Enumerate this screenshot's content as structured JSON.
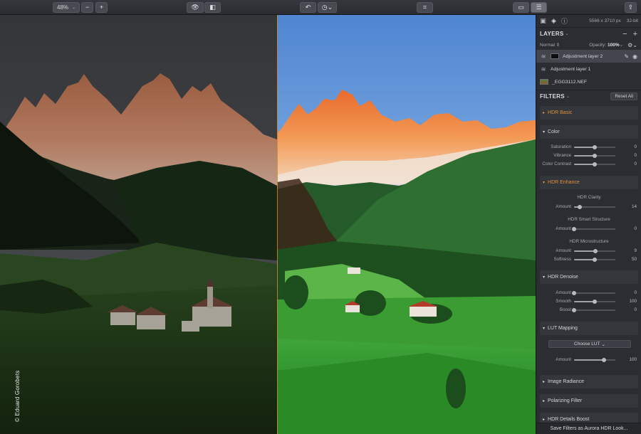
{
  "toolbar": {
    "zoom_value": "48%",
    "zoom_caret": "⌄",
    "zoom_out": "−",
    "zoom_in": "+",
    "icons": {
      "preview": "eye-icon",
      "compare": "split-compare-icon",
      "undo": "undo-icon",
      "history": "history-icon",
      "crop": "crop-icon",
      "layers_view": "panel-view-icon",
      "adjustments": "sliders-icon",
      "share": "share-icon"
    },
    "glyphs": {
      "preview": "👁",
      "compare": "◧",
      "undo": "↶",
      "history": "◷⌄",
      "crop": "⌗",
      "layers_view": "▭",
      "adjustments": "☰",
      "share": "⇪"
    }
  },
  "canvas": {
    "credit": "© Eduard Gorobets"
  },
  "panel": {
    "image_dimensions": "5566 x 3710 px",
    "bit_depth": "32-bit",
    "top_icons": [
      "image-icon",
      "layers-icon",
      "info-icon"
    ],
    "top_glyphs": [
      "▣",
      "◈",
      "ⓘ"
    ],
    "layers": {
      "title": "LAYERS",
      "caret": "⌄",
      "minus": "−",
      "plus": "+",
      "blend_mode": "Normal ⇕",
      "opacity_label": "Opacity:",
      "opacity_value": "100%",
      "opacity_caret": "⌄",
      "gear": "⚙⌄",
      "items": [
        {
          "name": "Adjustment layer 2",
          "icon": "≋"
        },
        {
          "name": "Adjustment layer 1",
          "icon": "≋"
        },
        {
          "name": "_EGG3112.NEF",
          "icon": ""
        }
      ],
      "brush_glyph": "✎",
      "eye_glyph": "◉"
    },
    "filters": {
      "title": "FILTERS",
      "caret": "⌄",
      "reset_label": "Reset All",
      "expanded_arrow": "▾",
      "collapsed_arrow": "▸",
      "sections": {
        "hdr_basic": "HDR Basic",
        "color": "Color",
        "hdr_enhance": "HDR Enhance",
        "hdr_denoise": "HDR Denoise",
        "lut_mapping": "LUT Mapping",
        "image_radiance": "Image Radiance",
        "polarizing_filter": "Polarizing Filter",
        "hdr_details_boost": "HDR Details Boost"
      },
      "color_sliders": [
        {
          "label": "Saturation",
          "value": "0",
          "pos": 0.5
        },
        {
          "label": "Vibrance",
          "value": "0",
          "pos": 0.5
        },
        {
          "label": "Color Contrast",
          "value": "0",
          "pos": 0.5
        }
      ],
      "hdr_clarity_title": "HDR Clarity",
      "hdr_clarity": {
        "label": "Amount",
        "value": "14",
        "pos": 0.14
      },
      "hdr_smart_structure_title": "HDR Smart Structure",
      "hdr_smart_structure": {
        "label": "Amount",
        "value": "0",
        "pos": 0.0
      },
      "hdr_microstructure_title": "HDR Microstructure",
      "hdr_microstructure": [
        {
          "label": "Amount",
          "value": "9",
          "pos": 0.52
        },
        {
          "label": "Softness",
          "value": "50",
          "pos": 0.5
        }
      ],
      "denoise_sliders": [
        {
          "label": "Amount",
          "value": "0",
          "pos": 0.0
        },
        {
          "label": "Smooth",
          "value": "100",
          "pos": 0.5
        },
        {
          "label": "Boost",
          "value": "0",
          "pos": 0.0
        }
      ],
      "lut_choose": "Choose LUT",
      "lut_caret": "⌄",
      "lut_amount": {
        "label": "Amount",
        "value": "100",
        "pos": 0.72
      }
    },
    "save_label": "Save Filters as Aurora HDR Look..."
  }
}
